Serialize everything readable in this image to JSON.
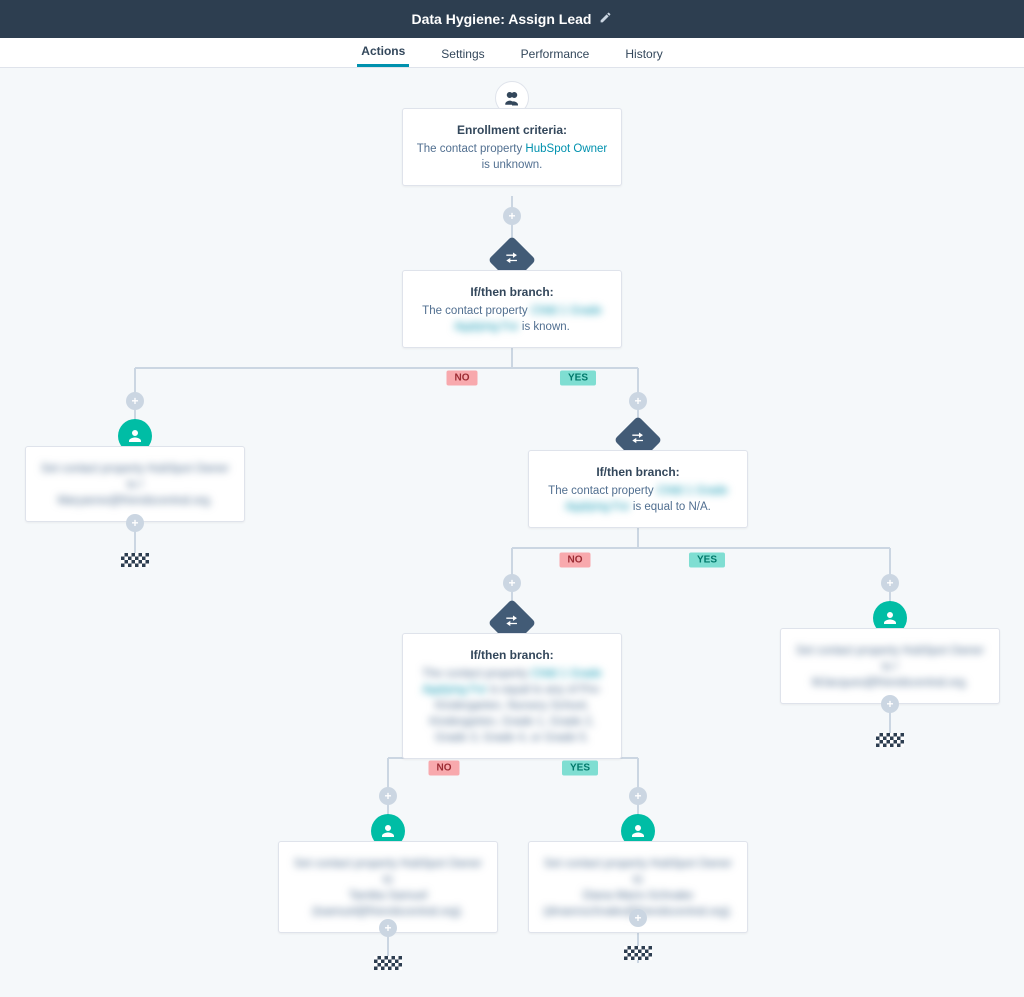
{
  "header": {
    "title": "Data Hygiene: Assign Lead"
  },
  "tabs": {
    "actions": "Actions",
    "settings": "Settings",
    "performance": "Performance",
    "history": "History"
  },
  "branch": {
    "no": "NO",
    "yes": "YES"
  },
  "cards": {
    "enroll": {
      "title": "Enrollment criteria:",
      "pre": "The contact property ",
      "link": "HubSpot Owner",
      "post": " is unknown."
    },
    "branch1": {
      "title": "If/then branch:",
      "pre": "The contact property ",
      "link": "Child 1 Grade Applying For",
      "post": " is known."
    },
    "set_left": {
      "line1": "Set contact property HubSpot Owner to /",
      "line2": "Maryanne@friendscentral.org."
    },
    "branch2": {
      "title": "If/then branch:",
      "pre": "The contact property ",
      "link": "Child 1 Grade Applying For",
      "post": " is equal to N/A."
    },
    "set_right": {
      "line1": "Set contact property HubSpot Owner to /",
      "line2": "MJacques@friendscentral.org."
    },
    "branch3": {
      "title": "If/then branch:",
      "pre": "The contact property ",
      "link": "Child 1 Grade Applying For",
      "post": " is equal to any of Pre-Kindergarten, Nursery School, Kindergarten, Grade 1, Grade 2, Grade 3, Grade 4, or Grade 5."
    },
    "set_bl": {
      "line1": "Set contact property HubSpot Owner to",
      "line2": "Tamika Samuel",
      "line3": "(tsamuel@friendscentral.org)."
    },
    "set_br": {
      "line1": "Set contact property HubSpot Owner to",
      "line2": "Diana Mann-Schnake (dmannschnake@friendscentral.org)."
    }
  }
}
